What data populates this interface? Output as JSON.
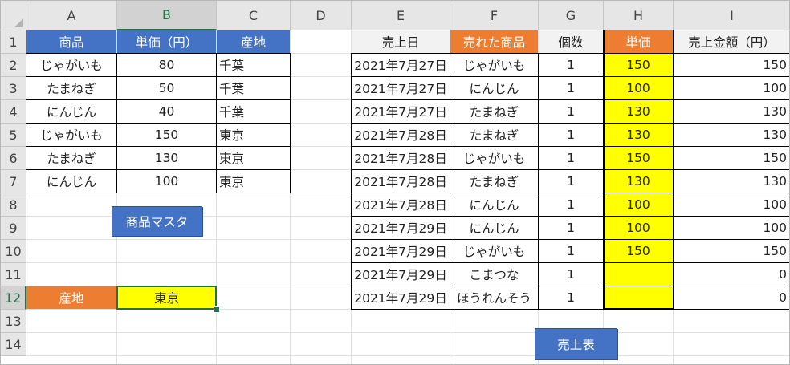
{
  "columns": [
    "A",
    "B",
    "C",
    "D",
    "E",
    "F",
    "G",
    "H",
    "I"
  ],
  "rows": [
    "1",
    "2",
    "3",
    "4",
    "5",
    "6",
    "7",
    "8",
    "9",
    "10",
    "11",
    "12",
    "13",
    "14"
  ],
  "master": {
    "headers": [
      "商品",
      "単価（円）",
      "産地"
    ],
    "rows": [
      [
        "じゃがいも",
        "80",
        "千葉"
      ],
      [
        "たまねぎ",
        "50",
        "千葉"
      ],
      [
        "にんじん",
        "40",
        "千葉"
      ],
      [
        "じゃがいも",
        "150",
        "東京"
      ],
      [
        "たまねぎ",
        "130",
        "東京"
      ],
      [
        "にんじん",
        "100",
        "東京"
      ]
    ],
    "button_label": "商品マスタ"
  },
  "filter": {
    "label": "産地",
    "value": "東京"
  },
  "sales": {
    "headers": [
      "売上日",
      "売れた商品",
      "個数",
      "単価",
      "売上金額（円）"
    ],
    "rows": [
      [
        "2021年7月27日",
        "じゃがいも",
        "1",
        "150",
        "150"
      ],
      [
        "2021年7月27日",
        "にんじん",
        "1",
        "100",
        "100"
      ],
      [
        "2021年7月27日",
        "たまねぎ",
        "1",
        "130",
        "130"
      ],
      [
        "2021年7月28日",
        "たまねぎ",
        "1",
        "130",
        "130"
      ],
      [
        "2021年7月28日",
        "じゃがいも",
        "1",
        "150",
        "150"
      ],
      [
        "2021年7月28日",
        "たまねぎ",
        "1",
        "130",
        "130"
      ],
      [
        "2021年7月28日",
        "にんじん",
        "1",
        "100",
        "100"
      ],
      [
        "2021年7月29日",
        "にんじん",
        "1",
        "100",
        "100"
      ],
      [
        "2021年7月29日",
        "じゃがいも",
        "1",
        "150",
        "150"
      ],
      [
        "2021年7月29日",
        "こまつな",
        "1",
        "",
        "0"
      ],
      [
        "2021年7月29日",
        "ほうれんそう",
        "1",
        "",
        "0"
      ]
    ],
    "button_label": "売上表"
  },
  "colors": {
    "blue_header": "#4472c4",
    "orange_header": "#ed7d31",
    "yellow_fill": "#ffff00",
    "sheet_gray": "#f2f2f2",
    "selection_green": "#217346"
  }
}
